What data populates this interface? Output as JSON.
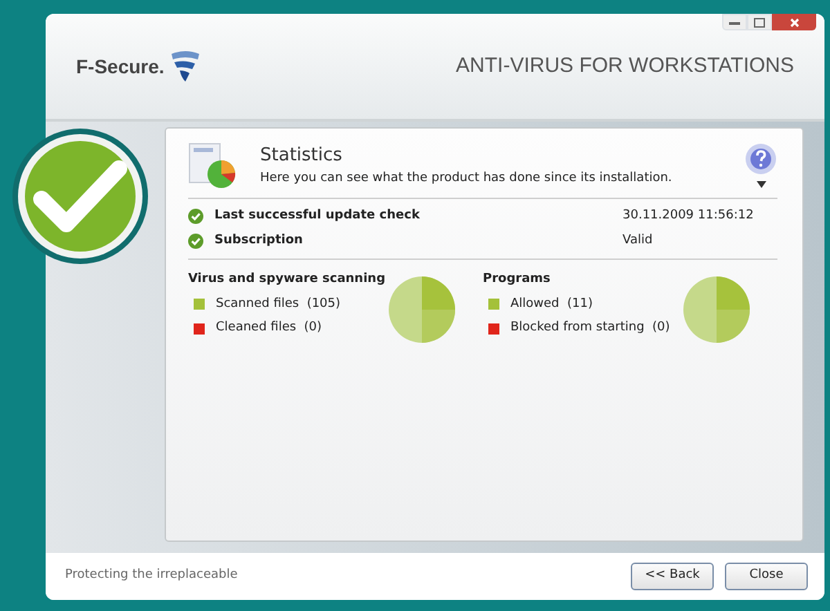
{
  "header": {
    "brand": "F-Secure.",
    "product": "ANTI-VIRUS FOR WORKSTATIONS"
  },
  "section": {
    "title": "Statistics",
    "description": "Here you can see what the product has done since its installation."
  },
  "status_rows": [
    {
      "label": "Last successful update check",
      "value": "30.11.2009 11:56:12"
    },
    {
      "label": "Subscription",
      "value": "Valid"
    }
  ],
  "groups": [
    {
      "title": "Virus and spyware scanning",
      "items": [
        {
          "label": "Scanned files  (105)",
          "color": "#a4c13a"
        },
        {
          "label": "Cleaned files  (0)",
          "color": "#e0251b"
        }
      ]
    },
    {
      "title": "Programs",
      "items": [
        {
          "label": "Allowed  (11)",
          "color": "#a4c13a"
        },
        {
          "label": "Blocked from starting  (0)",
          "color": "#e0251b"
        }
      ]
    }
  ],
  "footer": {
    "tagline": "Protecting the irreplaceable",
    "buttons": [
      "<< Back",
      "Close"
    ]
  }
}
